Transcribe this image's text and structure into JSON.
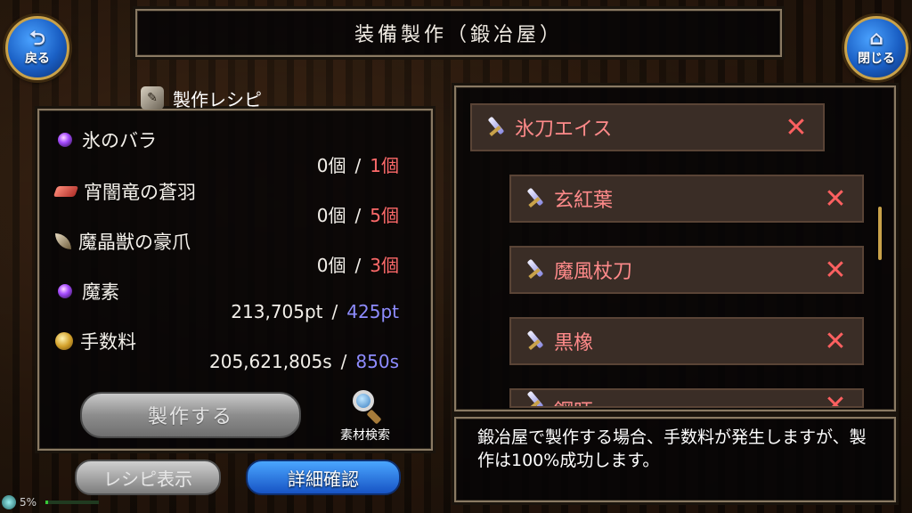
{
  "header": {
    "title": "装備製作（鍛冶屋）"
  },
  "nav": {
    "back_label": "戻る",
    "close_label": "閉じる"
  },
  "recipe": {
    "title": "製作レシピ",
    "materials": [
      {
        "name": "氷のバラ",
        "owned": "0個",
        "required": "1個",
        "icon": "purple-orb-icon"
      },
      {
        "name": "宵闇竜の蒼羽",
        "owned": "0個",
        "required": "5個",
        "icon": "feather-icon"
      },
      {
        "name": "魔晶獣の豪爪",
        "owned": "0個",
        "required": "3個",
        "icon": "claw-icon"
      },
      {
        "name": "魔素",
        "owned": "213,705pt",
        "required": "425pt",
        "icon": "purple-orb-icon"
      },
      {
        "name": "手数料",
        "owned": "205,621,805s",
        "required": "850s",
        "icon": "coin-icon"
      }
    ],
    "separator": "/",
    "craft_label": "製作する",
    "search_label": "素材検索"
  },
  "footer": {
    "recipe_view_label": "レシピ表示",
    "detail_label": "詳細確認",
    "status_percent": "5%",
    "status_fraction": 0.05
  },
  "item_list": [
    {
      "name": "氷刀エイス",
      "mark": "✕"
    },
    {
      "name": "玄紅葉",
      "mark": "✕"
    },
    {
      "name": "魔風杖刀",
      "mark": "✕"
    },
    {
      "name": "黒橡",
      "mark": "✕"
    },
    {
      "name": "鋼旺",
      "mark": "✕"
    }
  ],
  "message": "鍛冶屋で製作する場合、手数料が発生しますが、製作は100%成功します。",
  "colors": {
    "owned_insufficient": "#ff6a6a",
    "required_points": "#8e8cff",
    "item_name": "#ff8a8a"
  }
}
